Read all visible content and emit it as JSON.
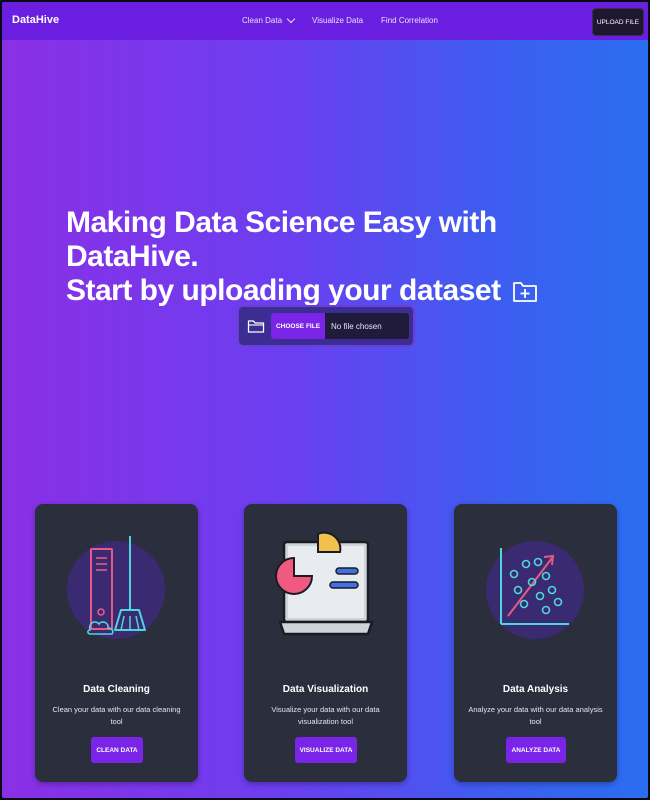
{
  "brand": "DataHive",
  "nav": {
    "links": [
      "Clean Data",
      "Visualize Data",
      "Find Correlation"
    ],
    "upload_button": "UPLOAD FILE"
  },
  "hero": {
    "line1": "Making Data Science Easy with DataHive.",
    "line2": "Start by uploading your dataset"
  },
  "file_input": {
    "button": "CHOOSE FILE",
    "status": "No file chosen"
  },
  "cards": [
    {
      "title": "Data Cleaning",
      "description": "Clean your data with our data cleaning tool",
      "button": "CLEAN DATA",
      "icon": "broom-server-icon"
    },
    {
      "title": "Data Visualization",
      "description": "Visualize your data with our data visualization tool",
      "button": "VISUALIZE DATA",
      "icon": "laptop-chart-icon"
    },
    {
      "title": "Data Analysis",
      "description": "Analyze your data with our data analysis tool",
      "button": "ANALYZE DATA",
      "icon": "scatter-plot-icon"
    }
  ],
  "colors": {
    "navbar": "#6a1fe0",
    "accent": "#7a24e8",
    "card_bg": "#2b2e3c",
    "gradient_start": "#8b2fe6",
    "gradient_end": "#2a6ef0"
  }
}
